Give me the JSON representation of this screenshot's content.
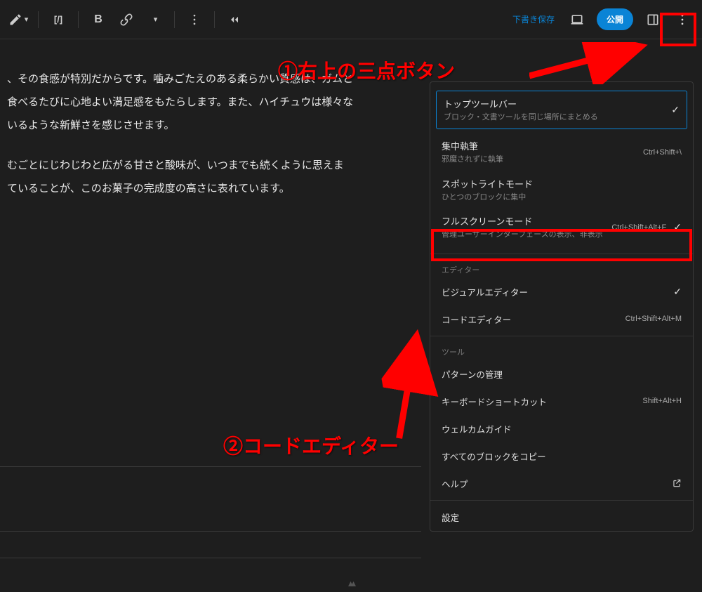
{
  "toolbar": {
    "draft_save": "下書き保存",
    "publish": "公開"
  },
  "content": {
    "p1": "、その食感が特別だからです。噛みごたえのある柔らかい質感は、ガムと",
    "p2": "食べるたびに心地よい満足感をもたらします。また、ハイチュウは様々な",
    "p3": "いるような新鮮さを感じさせます。",
    "p4": "むごとにじわじわと広がる甘さと酸味が、いつまでも続くように思えま",
    "p5": "ていることが、このお菓子の完成度の高さに表れています。"
  },
  "menu": {
    "top_toolbar": {
      "title": "トップツールバー",
      "sub": "ブロック・文書ツールを同じ場所にまとめる"
    },
    "focus": {
      "title": "集中執筆",
      "sub": "邪魔されずに執筆",
      "shortcut": "Ctrl+Shift+\\"
    },
    "spotlight": {
      "title": "スポットライトモード",
      "sub": "ひとつのブロックに集中"
    },
    "fullscreen": {
      "title": "フルスクリーンモード",
      "sub": "管理ユーザーインターフェースの表示、非表示",
      "shortcut": "Ctrl+Shift+Alt+F"
    },
    "editor_label": "エディター",
    "visual": {
      "title": "ビジュアルエディター"
    },
    "code": {
      "title": "コードエディター",
      "shortcut": "Ctrl+Shift+Alt+M"
    },
    "tool_label": "ツール",
    "patterns": {
      "title": "パターンの管理"
    },
    "keyboard": {
      "title": "キーボードショートカット",
      "shortcut": "Shift+Alt+H"
    },
    "welcome": {
      "title": "ウェルカムガイド"
    },
    "copy_all": {
      "title": "すべてのブロックをコピー"
    },
    "help": {
      "title": "ヘルプ"
    },
    "settings": {
      "title": "設定"
    }
  },
  "annotations": {
    "a1": "①右上の三点ボタン",
    "a2": "②コードエディター"
  }
}
